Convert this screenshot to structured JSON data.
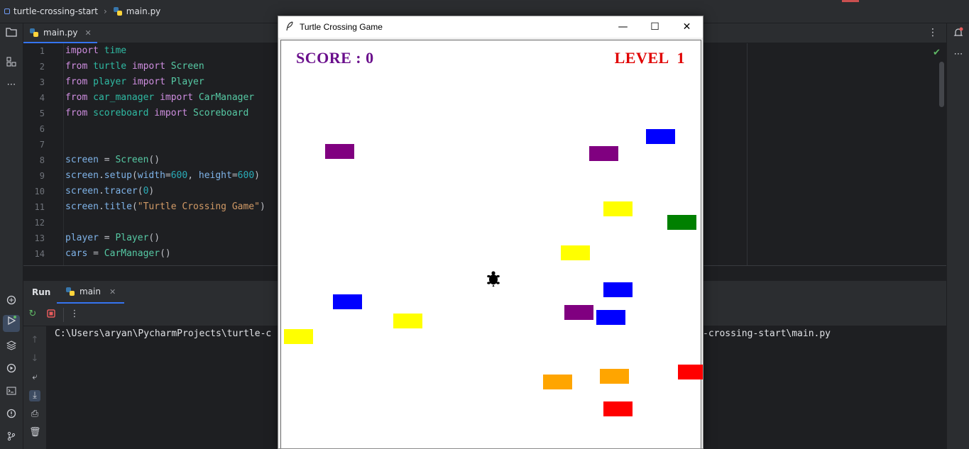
{
  "breadcrumb": {
    "project": "turtle-crossing-start",
    "file": "main.py"
  },
  "editor": {
    "tab_label": "main.py",
    "lines": [
      {
        "n": "1",
        "parts": [
          [
            "kw",
            "import"
          ],
          [
            "",
            " "
          ],
          [
            "mod",
            "time"
          ]
        ]
      },
      {
        "n": "2",
        "parts": [
          [
            "kw",
            "from"
          ],
          [
            "",
            " "
          ],
          [
            "mod",
            "turtle"
          ],
          [
            "",
            " "
          ],
          [
            "kw",
            "import"
          ],
          [
            "",
            " "
          ],
          [
            "cls",
            "Screen"
          ]
        ]
      },
      {
        "n": "3",
        "parts": [
          [
            "kw",
            "from"
          ],
          [
            "",
            " "
          ],
          [
            "mod",
            "player"
          ],
          [
            "",
            " "
          ],
          [
            "kw",
            "import"
          ],
          [
            "",
            " "
          ],
          [
            "cls",
            "Player"
          ]
        ]
      },
      {
        "n": "4",
        "parts": [
          [
            "kw",
            "from"
          ],
          [
            "",
            " "
          ],
          [
            "mod",
            "car_manager"
          ],
          [
            "",
            " "
          ],
          [
            "kw",
            "import"
          ],
          [
            "",
            " "
          ],
          [
            "cls",
            "CarManager"
          ]
        ]
      },
      {
        "n": "5",
        "parts": [
          [
            "kw",
            "from"
          ],
          [
            "",
            " "
          ],
          [
            "mod",
            "scoreboard"
          ],
          [
            "",
            " "
          ],
          [
            "kw",
            "import"
          ],
          [
            "",
            " "
          ],
          [
            "cls",
            "Scoreboard"
          ]
        ]
      },
      {
        "n": "6",
        "parts": []
      },
      {
        "n": "7",
        "parts": []
      },
      {
        "n": "8",
        "parts": [
          [
            "var",
            "screen"
          ],
          [
            "",
            " = "
          ],
          [
            "cls",
            "Screen"
          ],
          [
            "",
            "()"
          ]
        ]
      },
      {
        "n": "9",
        "parts": [
          [
            "var",
            "screen"
          ],
          [
            "",
            "."
          ],
          [
            "var",
            "setup"
          ],
          [
            "",
            "("
          ],
          [
            "var",
            "width"
          ],
          [
            "",
            "="
          ],
          [
            "num",
            "600"
          ],
          [
            "",
            ", "
          ],
          [
            "var",
            "height"
          ],
          [
            "",
            "="
          ],
          [
            "num",
            "600"
          ],
          [
            "",
            ")"
          ]
        ]
      },
      {
        "n": "10",
        "parts": [
          [
            "var",
            "screen"
          ],
          [
            "",
            "."
          ],
          [
            "var",
            "tracer"
          ],
          [
            "",
            "("
          ],
          [
            "num",
            "0"
          ],
          [
            "",
            ")"
          ]
        ]
      },
      {
        "n": "11",
        "parts": [
          [
            "var",
            "screen"
          ],
          [
            "",
            "."
          ],
          [
            "var",
            "title"
          ],
          [
            "",
            "("
          ],
          [
            "str",
            "\"Turtle Crossing Game\""
          ],
          [
            "",
            ")"
          ]
        ]
      },
      {
        "n": "12",
        "parts": []
      },
      {
        "n": "13",
        "parts": [
          [
            "var",
            "player"
          ],
          [
            "",
            " = "
          ],
          [
            "cls",
            "Player"
          ],
          [
            "",
            "()"
          ]
        ]
      },
      {
        "n": "14",
        "parts": [
          [
            "var",
            "cars"
          ],
          [
            "",
            " = "
          ],
          [
            "cls",
            "CarManager"
          ],
          [
            "",
            "()"
          ]
        ]
      }
    ]
  },
  "run": {
    "label": "Run",
    "tab_label": "main",
    "console_left": "C:\\Users\\aryan\\PycharmProjects\\turtle-c",
    "console_right": "-crossing-start\\main.py"
  },
  "turtle_window": {
    "title": "Turtle Crossing Game",
    "minimize": "—",
    "maximize": "☐",
    "close": "✕",
    "score_text": "SCORE : 0",
    "level_text": "LEVEL  1",
    "colors": {
      "score": "#6a0f8c",
      "level": "#e00000"
    },
    "cars": [
      {
        "color": "#800080"
      },
      {
        "color": "#800080"
      },
      {
        "color": "#0000ff"
      },
      {
        "color": "#ffff00"
      },
      {
        "color": "#008000"
      },
      {
        "color": "#ffff00"
      },
      {
        "color": "#0000ff"
      },
      {
        "color": "#0000ff"
      },
      {
        "color": "#800080"
      },
      {
        "color": "#0000ff"
      },
      {
        "color": "#ffff00"
      },
      {
        "color": "#ffff00"
      },
      {
        "color": "#ffa500"
      },
      {
        "color": "#ff0000"
      },
      {
        "color": "#ffa500"
      },
      {
        "color": "#ff0000"
      }
    ],
    "player": {
      "color": "#000000",
      "shape": "turtle-icon"
    }
  },
  "icons": {
    "left_strip": [
      "folder-icon",
      "structure-icon",
      "more-icon",
      "python-console-icon",
      "run-icon",
      "layers-icon",
      "services-icon",
      "terminal-icon",
      "problems-icon",
      "git-icon"
    ],
    "right_strip": [
      "notifications-icon",
      "more-icon"
    ]
  }
}
